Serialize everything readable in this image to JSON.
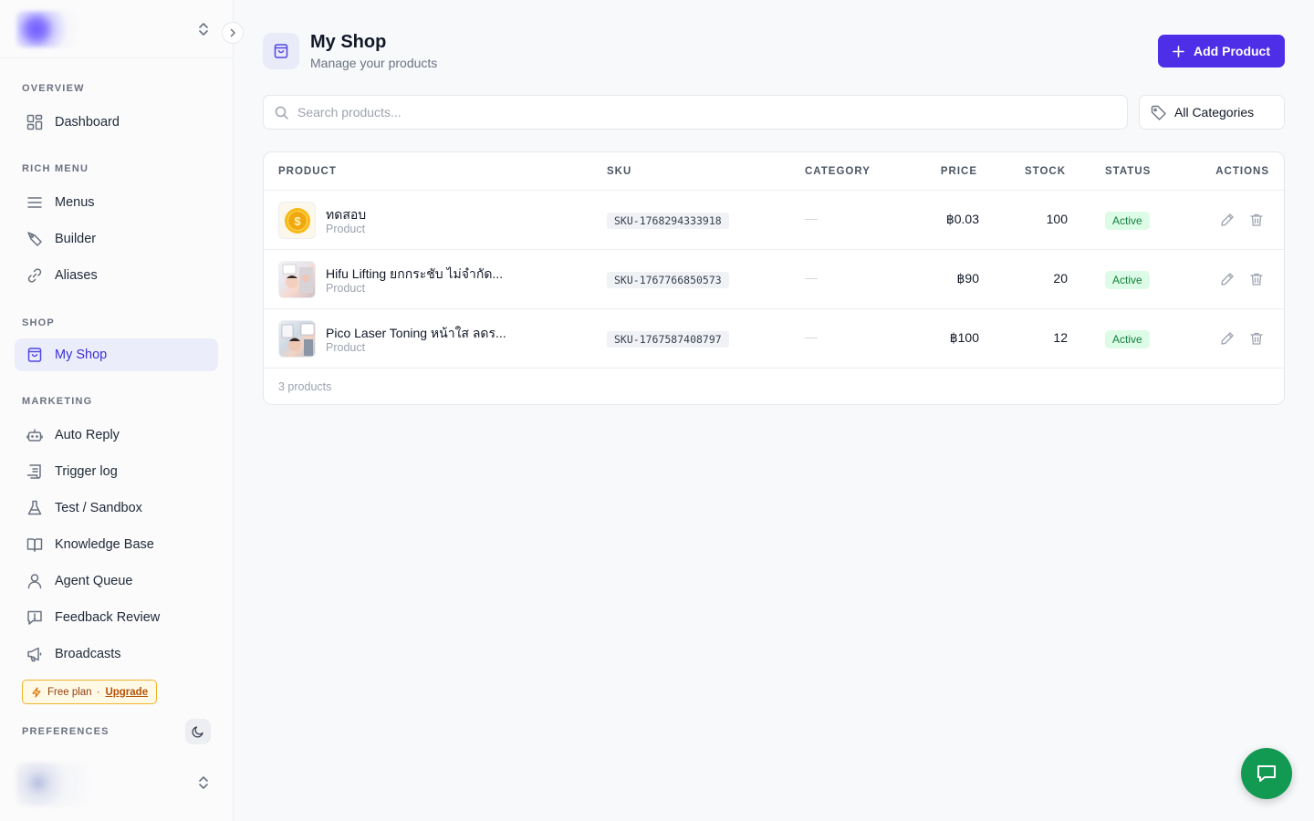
{
  "sidebar": {
    "sections": [
      {
        "title": "OVERVIEW",
        "items": [
          {
            "label": "Dashboard"
          }
        ]
      },
      {
        "title": "RICH MENU",
        "items": [
          {
            "label": "Menus"
          },
          {
            "label": "Builder"
          },
          {
            "label": "Aliases"
          }
        ]
      },
      {
        "title": "SHOP",
        "items": [
          {
            "label": "My Shop"
          }
        ]
      },
      {
        "title": "MARKETING",
        "items": [
          {
            "label": "Auto Reply"
          },
          {
            "label": "Trigger log"
          },
          {
            "label": "Test / Sandbox"
          },
          {
            "label": "Knowledge Base"
          },
          {
            "label": "Agent Queue"
          },
          {
            "label": "Feedback Review"
          },
          {
            "label": "Broadcasts"
          }
        ]
      }
    ],
    "active_item": "My Shop",
    "plan": {
      "label": "Free plan",
      "separator": "·",
      "upgrade": "Upgrade"
    },
    "preferences_label": "PREFERENCES"
  },
  "header": {
    "title": "My Shop",
    "subtitle": "Manage your products",
    "add_button_label": "Add Product"
  },
  "filters": {
    "search_placeholder": "Search products...",
    "search_value": "",
    "category_selected": "All Categories"
  },
  "table": {
    "columns": [
      "PRODUCT",
      "SKU",
      "CATEGORY",
      "PRICE",
      "STOCK",
      "STATUS",
      "ACTIONS"
    ],
    "rows": [
      {
        "name": "ทดสอบ",
        "type": "Product",
        "sku": "SKU-1768294333918",
        "category": "—",
        "price": "฿0.03",
        "stock": "100",
        "status": "Active",
        "thumb": "coin-image"
      },
      {
        "name": "Hifu Lifting ยกกระชับ ไม่จำกัด...",
        "type": "Product",
        "sku": "SKU-1767766850573",
        "category": "—",
        "price": "฿90",
        "stock": "20",
        "status": "Active",
        "thumb": "hifu-photo"
      },
      {
        "name": "Pico Laser Toning หน้าใส ลดร...",
        "type": "Product",
        "sku": "SKU-1767587408797",
        "category": "—",
        "price": "฿100",
        "stock": "12",
        "status": "Active",
        "thumb": "pico-photo"
      }
    ],
    "footer_count": "3 products"
  },
  "colors": {
    "accent": "#4f2ee8",
    "active_nav_bg": "#ecedfb",
    "status_bg": "#dcfce7",
    "status_text": "#15803d",
    "chat_fab": "#129a52"
  },
  "icons": {
    "nav": [
      "dashboard-icon",
      "menu-lines-icon",
      "builder-icon",
      "link-icon",
      "shopping-bag-icon",
      "bot-icon",
      "log-icon",
      "flask-icon",
      "book-icon",
      "user-icon",
      "feedback-icon",
      "megaphone-icon"
    ],
    "actions": [
      "edit-icon",
      "trash-icon"
    ]
  }
}
